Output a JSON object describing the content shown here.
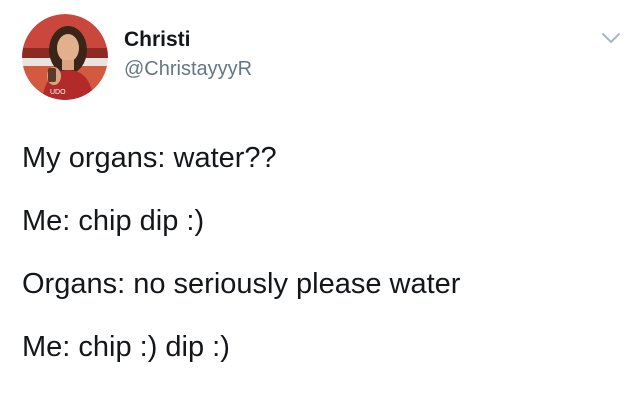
{
  "user": {
    "display_name": "Christi",
    "handle": "@ChristayyyR",
    "avatar_icon": "profile-photo",
    "avatar_bg": "#b83a32"
  },
  "menu": {
    "icon": "chevron-down-icon",
    "color": "#aab8c2"
  },
  "tweet": {
    "lines": [
      "My organs: water??",
      "Me: chip dip :)",
      "Organs: no seriously please water",
      "Me: chip :) dip :)"
    ]
  }
}
